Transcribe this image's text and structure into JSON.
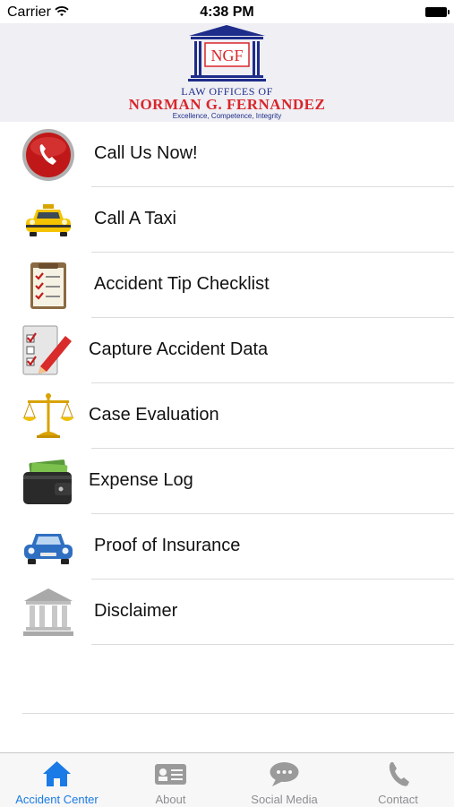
{
  "status_bar": {
    "carrier": "Carrier",
    "time": "4:38 PM"
  },
  "header": {
    "logo_initials": "NGF",
    "line1": "LAW OFFICES OF",
    "line2": "NORMAN G. FERNANDEZ",
    "line3": "Excellence, Competence, Integrity"
  },
  "menu": {
    "items": [
      {
        "label": "Call Us Now!",
        "icon": "phone-icon"
      },
      {
        "label": "Call A Taxi",
        "icon": "taxi-icon"
      },
      {
        "label": "Accident Tip Checklist",
        "icon": "checklist-icon"
      },
      {
        "label": "Capture Accident Data",
        "icon": "clipboard-pencil-icon"
      },
      {
        "label": "Case Evaluation",
        "icon": "scales-icon"
      },
      {
        "label": "Expense Log",
        "icon": "wallet-icon"
      },
      {
        "label": "Proof of Insurance",
        "icon": "car-icon"
      },
      {
        "label": "Disclaimer",
        "icon": "courthouse-icon"
      }
    ]
  },
  "tab_bar": {
    "tabs": [
      {
        "label": "Accident Center",
        "icon": "home-icon",
        "active": true
      },
      {
        "label": "About",
        "icon": "id-card-icon",
        "active": false
      },
      {
        "label": "Social Media",
        "icon": "chat-bubble-icon",
        "active": false
      },
      {
        "label": "Contact",
        "icon": "phone-handset-icon",
        "active": false
      }
    ]
  },
  "colors": {
    "active_tab": "#1a7ae6",
    "inactive_tab": "#8e8e93",
    "logo_blue": "#1e2c8a",
    "logo_red": "#d8262b"
  }
}
